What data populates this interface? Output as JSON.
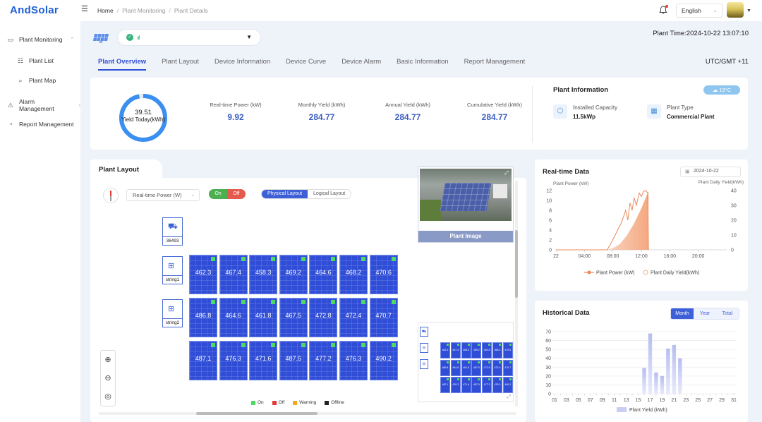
{
  "app": {
    "logo": "AndSolar"
  },
  "breadcrumb": {
    "home": "Home",
    "sep1": "/",
    "level1": "Plant Monitoring",
    "sep2": "/",
    "level2": "Plant Details"
  },
  "header": {
    "language": "English"
  },
  "sidebar": {
    "items": [
      {
        "label": "Plant Monitoring",
        "icon": "monitor-icon"
      },
      {
        "label": "Plant List",
        "icon": "list-icon"
      },
      {
        "label": "Plant Map",
        "icon": "map-search-icon"
      },
      {
        "label": "Alarm Management",
        "icon": "alarm-icon"
      },
      {
        "label": "Report Management",
        "icon": "report-icon"
      }
    ]
  },
  "plant": {
    "select_signal": "ııl",
    "time": "Plant Time:2024-10-22 13:07:10",
    "timezone": "UTC/GMT +11"
  },
  "tabs": [
    {
      "label": "Plant Overview",
      "active": true
    },
    {
      "label": "Plant Layout"
    },
    {
      "label": "Device Information"
    },
    {
      "label": "Device Curve"
    },
    {
      "label": "Device Alarm"
    },
    {
      "label": "Basic Information"
    },
    {
      "label": "Report Management"
    }
  ],
  "overview": {
    "today_value": "39.51",
    "today_label": "Yield Today(kWh)",
    "today_ring_fraction": 0.97,
    "stats": [
      {
        "label": "Real-time Power (kW)",
        "value": "9.92"
      },
      {
        "label": "Monthly Yield (kWh)",
        "value": "284.77"
      },
      {
        "label": "Annual Yield (kWh)",
        "value": "284.77"
      },
      {
        "label": "Cumulative Yield (kWh)",
        "value": "284.77"
      }
    ],
    "info_title": "Plant Information",
    "temperature": "19°C",
    "capacity_label": "Installed Capacity",
    "capacity_value": "11.5kWp",
    "type_label": "Plant Type",
    "type_value": "Commercial Plant"
  },
  "layout": {
    "title": "Plant Layout",
    "metric_select": "Real-time Power (W)",
    "on_label": "On",
    "off_label": "Off",
    "physical_label": "Physical Layout",
    "logical_label": "Logical Layout",
    "devices": [
      {
        "label": "36493",
        "icon": "inverter-icon"
      },
      {
        "label": "string1",
        "icon": "string-icon"
      },
      {
        "label": "string2",
        "icon": "string-icon"
      }
    ],
    "panels": [
      [
        "462.3",
        "467.4",
        "458.3",
        "469.2",
        "464.6",
        "468.2",
        "470.6"
      ],
      [
        "486.8",
        "464.6",
        "461.8",
        "467.5",
        "472.8",
        "472.4",
        "470.7"
      ],
      [
        "487.1",
        "476.3",
        "471.6",
        "487.5",
        "477.2",
        "476.3",
        "490.2"
      ]
    ],
    "image_label": "Plant Image",
    "legend": [
      {
        "label": "On",
        "color": "#4cd964"
      },
      {
        "label": "Off",
        "color": "#e53935"
      },
      {
        "label": "Warning",
        "color": "#f5a623"
      },
      {
        "label": "Offline",
        "color": "#222222"
      }
    ]
  },
  "realtime": {
    "title": "Real-time Data",
    "date": "2024-10-22",
    "chart_data": {
      "type": "area",
      "left_axis_label": "Plant Power (kW)",
      "right_axis_label": "Plant Daily Yield(kWh)",
      "left_ticks": [
        "0",
        "2",
        "4",
        "6",
        "8",
        "10",
        "12"
      ],
      "right_ticks": [
        "0",
        "10",
        "20",
        "30",
        "40"
      ],
      "x_ticks": [
        "22",
        "04:00",
        "08:00",
        "12:00",
        "16:00",
        "20:00"
      ],
      "x_range_hours": [
        0,
        24
      ],
      "left_range": [
        0,
        12
      ],
      "right_range": [
        0,
        40
      ],
      "series": [
        {
          "name": "Plant Power (kW)",
          "color": "#e8895a",
          "points": [
            [
              0,
              0
            ],
            [
              7.2,
              0
            ],
            [
              7.8,
              1.5
            ],
            [
              8.5,
              3.5
            ],
            [
              9.2,
              5.5
            ],
            [
              9.8,
              8
            ],
            [
              10.1,
              6
            ],
            [
              10.4,
              9.5
            ],
            [
              10.7,
              8
            ],
            [
              11.0,
              10.5
            ],
            [
              11.3,
              9
            ],
            [
              11.7,
              11.5
            ],
            [
              12.0,
              10.8
            ],
            [
              12.3,
              11.8
            ],
            [
              12.6,
              12
            ],
            [
              12.9,
              11.5
            ],
            [
              13.0,
              0
            ]
          ]
        },
        {
          "name": "Plant Daily Yield(kWh)",
          "color": "#f5b08a",
          "points": [
            [
              0,
              0
            ],
            [
              7.2,
              0
            ],
            [
              8,
              1
            ],
            [
              9,
              4
            ],
            [
              10,
              10
            ],
            [
              11,
              18
            ],
            [
              12,
              28
            ],
            [
              13,
              39.51
            ],
            [
              13,
              0
            ]
          ]
        }
      ]
    }
  },
  "historical": {
    "title": "Historical Data",
    "ranges": [
      "Month",
      "Year",
      "Total"
    ],
    "active_range": "Month",
    "chart_data": {
      "type": "bar",
      "y_ticks": [
        "0",
        "10",
        "20",
        "30",
        "40",
        "50",
        "60",
        "70"
      ],
      "y_range": [
        0,
        70
      ],
      "x_ticks": [
        "01",
        "03",
        "05",
        "07",
        "09",
        "11",
        "13",
        "15",
        "17",
        "19",
        "21",
        "23",
        "25",
        "27",
        "29",
        "31"
      ],
      "days": [
        1,
        31
      ],
      "series": [
        {
          "name": "Plant Yield (kWh)",
          "color": "#c9cdf4",
          "values": [
            [
              16,
              29
            ],
            [
              17,
              68
            ],
            [
              18,
              24
            ],
            [
              19,
              20
            ],
            [
              20,
              51
            ],
            [
              21,
              55
            ],
            [
              22,
              40
            ]
          ]
        }
      ]
    }
  }
}
